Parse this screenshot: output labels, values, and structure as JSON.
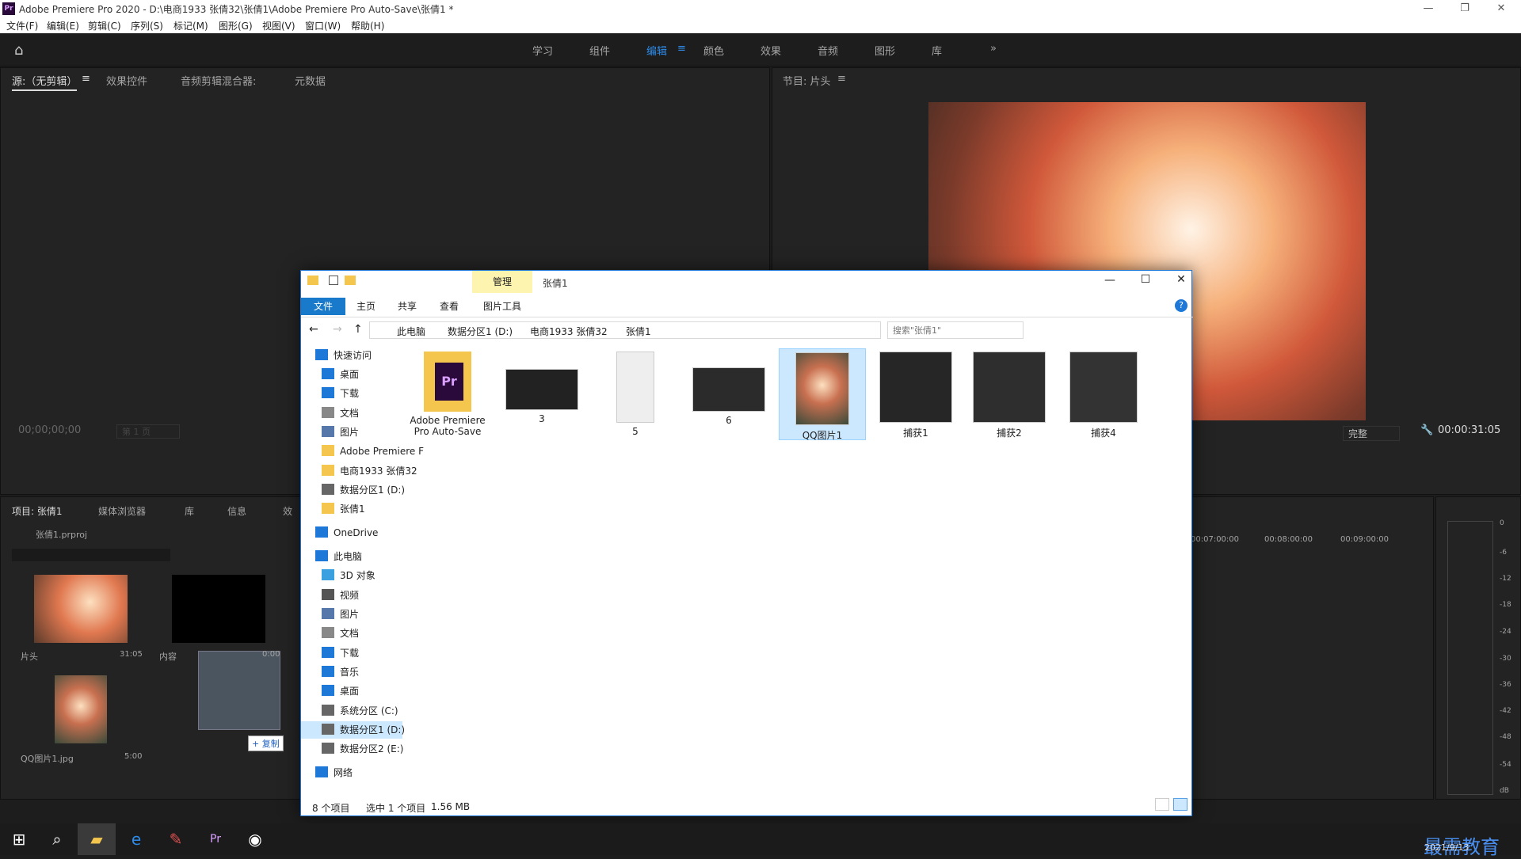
{
  "titlebar": {
    "title": "Adobe Premiere Pro 2020 - D:\\电商1933 张倩32\\张倩1\\Adobe Premiere Pro Auto-Save\\张倩1 *"
  },
  "menu": [
    "文件(F)",
    "编辑(E)",
    "剪辑(C)",
    "序列(S)",
    "标记(M)",
    "图形(G)",
    "视图(V)",
    "窗口(W)",
    "帮助(H)"
  ],
  "workspaces": [
    "学习",
    "组件",
    "编辑",
    "颜色",
    "效果",
    "音频",
    "图形",
    "库"
  ],
  "active_workspace": "编辑",
  "source_panel": {
    "tabs": [
      "源:（无剪辑）",
      "效果控件",
      "音频剪辑混合器:",
      "元数据"
    ],
    "timecode": "00;00;00;00",
    "page": "第 1 页"
  },
  "program_panel": {
    "title": "节目: 片头",
    "quality": "完整",
    "timecode": "00:00:31:05"
  },
  "project_panel": {
    "tabs": [
      "项目: 张倩1",
      "媒体浏览器",
      "库",
      "信息",
      "效"
    ],
    "file": "张倩1.prproj",
    "items": [
      {
        "name": "片头",
        "dur": "31:05"
      },
      {
        "name": "内容",
        "dur": "0:00"
      },
      {
        "name": "QQ图片1.jpg",
        "dur": "5:00"
      }
    ],
    "copy_badge": "+ 复制"
  },
  "timeline": {
    "ticks": [
      "00:07:00:00",
      "00:08:00:00",
      "00:09:00:00"
    ]
  },
  "meter": {
    "labels": [
      "0",
      "-6",
      "-12",
      "-18",
      "-24",
      "-30",
      "-36",
      "-42",
      "-48",
      "-54",
      "dB"
    ]
  },
  "explorer": {
    "title": "张倩1",
    "manage_tab": "管理",
    "ribbon": [
      "文件",
      "主页",
      "共享",
      "查看",
      "图片工具"
    ],
    "breadcrumb": [
      "此电脑",
      "数据分区1 (D:)",
      "电商1933 张倩32",
      "张倩1"
    ],
    "search_placeholder": "搜索\"张倩1\"",
    "nav": [
      {
        "label": "快速访问",
        "icon": "star-icon",
        "indent": 0
      },
      {
        "label": "桌面",
        "icon": "desktop-icon",
        "indent": 1,
        "pin": true
      },
      {
        "label": "下载",
        "icon": "download-icon",
        "indent": 1,
        "pin": true
      },
      {
        "label": "文档",
        "icon": "document-icon",
        "indent": 1,
        "pin": true
      },
      {
        "label": "图片",
        "icon": "picture-icon",
        "indent": 1,
        "pin": true
      },
      {
        "label": "Adobe Premiere F",
        "icon": "folder-icon",
        "indent": 1
      },
      {
        "label": "电商1933 张倩32",
        "icon": "folder-icon",
        "indent": 1
      },
      {
        "label": "数据分区1 (D:)",
        "icon": "drive-icon",
        "indent": 1
      },
      {
        "label": "张倩1",
        "icon": "folder-icon",
        "indent": 1
      },
      {
        "label": "OneDrive",
        "icon": "cloud-icon",
        "indent": 0
      },
      {
        "label": "此电脑",
        "icon": "computer-icon",
        "indent": 0
      },
      {
        "label": "3D 对象",
        "icon": "cube-icon",
        "indent": 1
      },
      {
        "label": "视频",
        "icon": "video-icon",
        "indent": 1
      },
      {
        "label": "图片",
        "icon": "picture-icon",
        "indent": 1
      },
      {
        "label": "文档",
        "icon": "document-icon",
        "indent": 1
      },
      {
        "label": "下载",
        "icon": "download-icon",
        "indent": 1
      },
      {
        "label": "音乐",
        "icon": "music-icon",
        "indent": 1
      },
      {
        "label": "桌面",
        "icon": "desktop-icon",
        "indent": 1
      },
      {
        "label": "系统分区 (C:)",
        "icon": "drive-icon",
        "indent": 1
      },
      {
        "label": "数据分区1 (D:)",
        "icon": "drive-icon",
        "indent": 1,
        "selected": true
      },
      {
        "label": "数据分区2 (E:)",
        "icon": "drive-icon",
        "indent": 1
      },
      {
        "label": "网络",
        "icon": "network-icon",
        "indent": 0
      }
    ],
    "files": [
      "Adobe Premiere Pro Auto-Save",
      "3",
      "5",
      "6",
      "QQ图片1",
      "捕获1",
      "捕获2",
      "捕获4"
    ],
    "status": {
      "count": "8 个项目",
      "selected": "选中 1 个项目",
      "size": "1.56 MB"
    }
  },
  "tray": {
    "time": "",
    "date": "2021/9/13",
    "watermark": "最需教育"
  }
}
